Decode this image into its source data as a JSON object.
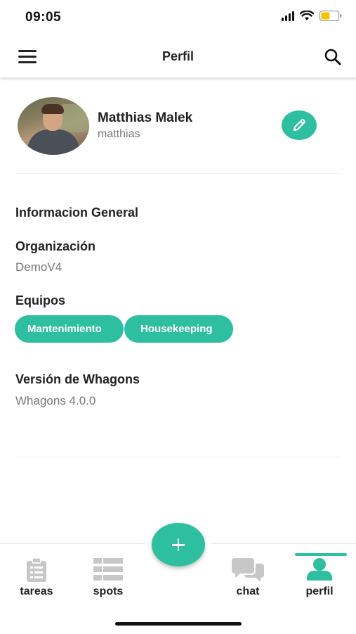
{
  "status_bar": {
    "time": "09:05"
  },
  "header": {
    "title": "Perfil"
  },
  "profile": {
    "name": "Matthias Malek",
    "username": "matthias"
  },
  "info": {
    "section_title": "Informacion General",
    "organization_label": "Organización",
    "organization_value": "DemoV4",
    "teams_label": "Equipos",
    "teams": [
      "Mantenimiento",
      "Housekeeping"
    ],
    "version_label": "Versión de Whagons",
    "version_value": "Whagons 4.0.0"
  },
  "bottom_nav": {
    "items": [
      {
        "label": "tareas",
        "icon": "clipboard-icon"
      },
      {
        "label": "spots",
        "icon": "grid-list-icon"
      },
      {
        "label": "chat",
        "icon": "chat-bubbles-icon"
      },
      {
        "label": "perfil",
        "icon": "person-icon",
        "active": true
      }
    ],
    "fab_icon": "plus-icon"
  },
  "colors": {
    "accent": "#2dbfa0",
    "icon_gray": "#c7c7c7",
    "text_dark": "#222222",
    "text_muted": "#777777"
  }
}
